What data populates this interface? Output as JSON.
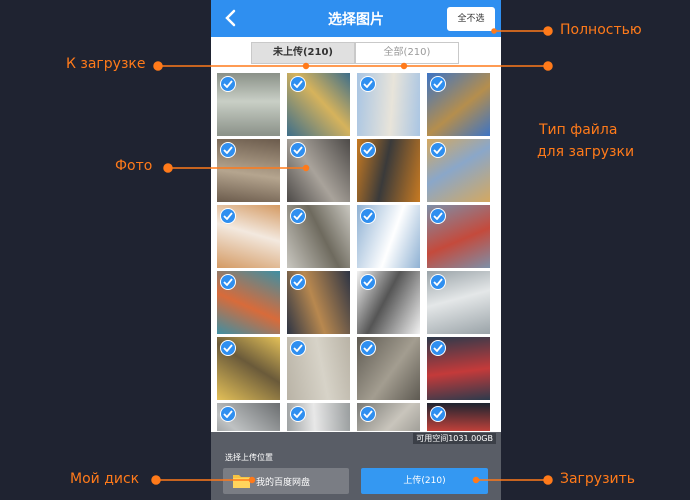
{
  "header": {
    "title": "选择图片",
    "deselect_label": "全不选"
  },
  "tabs": [
    {
      "label": "未上传(210)",
      "active": true
    },
    {
      "label": "全部(210)",
      "active": false
    }
  ],
  "grid": {
    "rows": 6,
    "cols": 4,
    "all_selected": true
  },
  "footer": {
    "free_space": "可用空间1031.00GB",
    "location_label": "选择上传位置",
    "my_disk_label": "我的百度网盘",
    "upload_label": "上传(210)"
  },
  "annotations": {
    "full": "Полностью",
    "to_upload": "К загрузке",
    "file_type_1": "Тип файла",
    "file_type_2": "для загрузки",
    "photo": "Фото",
    "my_disk": "Мой диск",
    "upload": "Загрузить"
  },
  "colors": {
    "accent": "#2f8ff0",
    "annotation": "#ff7a1a",
    "background": "#1f2331"
  },
  "icons": [
    "back-arrow-icon",
    "check-icon",
    "folder-icon"
  ]
}
